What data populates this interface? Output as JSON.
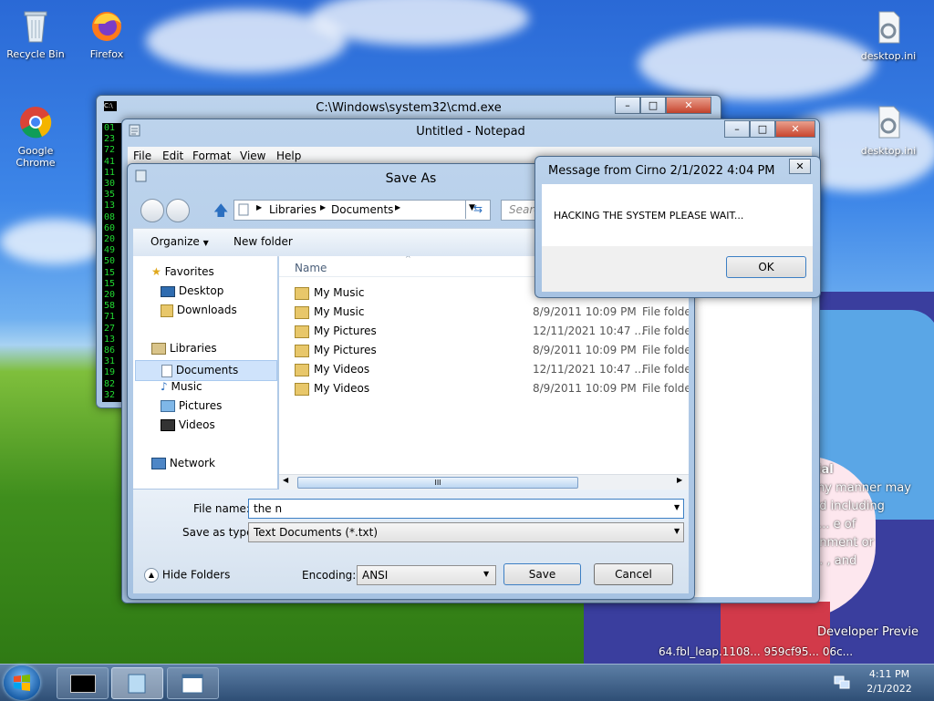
{
  "desktop": {
    "icons": [
      {
        "label": "Recycle Bin"
      },
      {
        "label": "Firefox"
      },
      {
        "label": "Google Chrome"
      },
      {
        "label": "desktop.ini"
      },
      {
        "label": "desktop.ini"
      }
    ],
    "watermark": {
      "line1": "ial",
      "line2": "any manner may",
      "line3": "nd including",
      "line4": "c... e of",
      "line5": "gnment or",
      "line6": "... , and",
      "build1": "Developer Previe",
      "build2": "64.fbl_leap.1108... 959cf95... 06c..."
    }
  },
  "cmd": {
    "title": "C:\\Windows\\system32\\cmd.exe",
    "icon_text": "C:\\",
    "numbers": [
      "01",
      "23",
      "72",
      "41",
      "11",
      "30",
      "35",
      "13",
      "08",
      "60",
      "20",
      "49",
      "50",
      "15",
      "15",
      "20",
      "58",
      "71",
      "27",
      "13",
      "86",
      "31",
      "19",
      "82",
      "32"
    ]
  },
  "notepad": {
    "title": "Untitled - Notepad",
    "menu": [
      "File",
      "Edit",
      "Format",
      "View",
      "Help"
    ]
  },
  "saveas": {
    "title": "Save As",
    "breadcrumb": [
      "Libraries",
      "Documents"
    ],
    "search_placeholder": "Search",
    "toolbar": {
      "organize": "Organize",
      "new_folder": "New folder"
    },
    "nav": {
      "favorites": "Favorites",
      "desktop": "Desktop",
      "downloads": "Downloads",
      "libraries": "Libraries",
      "documents": "Documents",
      "music": "Music",
      "pictures": "Pictures",
      "videos": "Videos",
      "network": "Network"
    },
    "columns": {
      "name": "Name"
    },
    "files": [
      {
        "name": "My Music",
        "date": "",
        "type": ""
      },
      {
        "name": "My Music",
        "date": "8/9/2011 10:09 PM",
        "type": "File folder"
      },
      {
        "name": "My Pictures",
        "date": "12/11/2021 10:47 ...",
        "type": "File folder"
      },
      {
        "name": "My Pictures",
        "date": "8/9/2011 10:09 PM",
        "type": "File folder"
      },
      {
        "name": "My Videos",
        "date": "12/11/2021 10:47 ...",
        "type": "File folder"
      },
      {
        "name": "My Videos",
        "date": "8/9/2011 10:09 PM",
        "type": "File folder"
      }
    ],
    "scroll_grip": "III",
    "filename_label": "File name:",
    "filename_value": "the n",
    "savetype_label": "Save as type:",
    "savetype_value": "Text Documents (*.txt)",
    "hide_folders": "Hide Folders",
    "encoding_label": "Encoding:",
    "encoding_value": "ANSI",
    "save_label": "Save",
    "cancel_label": "Cancel"
  },
  "message": {
    "title": "Message from Cirno 2/1/2022 4:04 PM",
    "body": "HACKING THE SYSTEM PLEASE WAIT...",
    "ok_label": "OK"
  },
  "taskbar": {
    "time": "4:11 PM",
    "date": "2/1/2022"
  },
  "colors": {
    "cmd_text": "#22dd33",
    "selection": "#cfe3fb",
    "taskbar_top": "#5d7fa6"
  }
}
